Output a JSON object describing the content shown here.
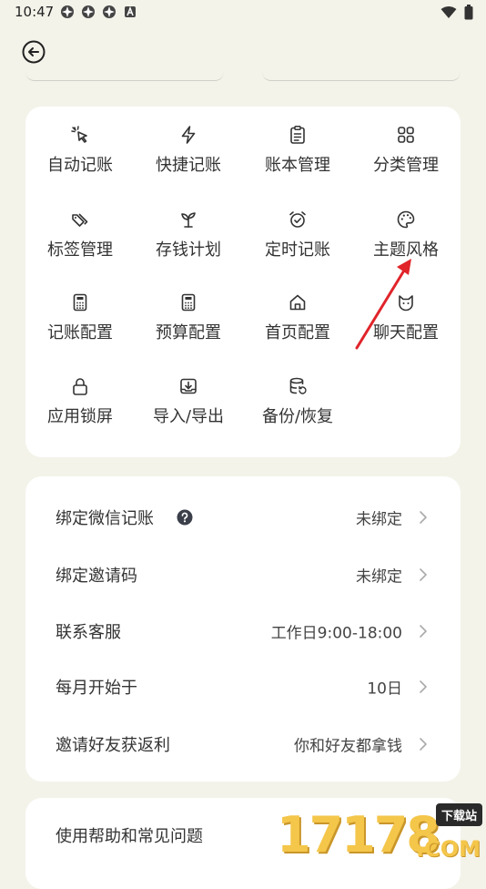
{
  "status_bar": {
    "time": "10:47"
  },
  "grid": [
    {
      "label": "自动记账",
      "icon": "cursor-click-icon"
    },
    {
      "label": "快捷记账",
      "icon": "lightning-icon"
    },
    {
      "label": "账本管理",
      "icon": "clipboard-icon"
    },
    {
      "label": "分类管理",
      "icon": "grid-icon"
    },
    {
      "label": "标签管理",
      "icon": "tags-icon"
    },
    {
      "label": "存钱计划",
      "icon": "sprout-icon"
    },
    {
      "label": "定时记账",
      "icon": "alarm-clock-icon"
    },
    {
      "label": "主题风格",
      "icon": "palette-icon"
    },
    {
      "label": "记账配置",
      "icon": "calculator-icon"
    },
    {
      "label": "预算配置",
      "icon": "calculator-icon"
    },
    {
      "label": "首页配置",
      "icon": "home-icon"
    },
    {
      "label": "聊天配置",
      "icon": "cat-icon"
    },
    {
      "label": "应用锁屏",
      "icon": "lock-icon"
    },
    {
      "label": "导入/导出",
      "icon": "download-tray-icon"
    },
    {
      "label": "备份/恢复",
      "icon": "database-restore-icon"
    }
  ],
  "settings": [
    {
      "label": "绑定微信记账",
      "value": "未绑定",
      "help": true
    },
    {
      "label": "绑定邀请码",
      "value": "未绑定"
    },
    {
      "label": "联系客服",
      "value": "工作日9:00-18:00"
    },
    {
      "label": "每月开始于",
      "value": "10日"
    },
    {
      "label": "邀请好友获返利",
      "value": "你和好友都拿钱"
    }
  ],
  "bottom": {
    "label": "使用帮助和常见问题"
  },
  "watermark": {
    "logo": "17178",
    "badge": "下载站",
    "suffix": ".COM"
  },
  "colors": {
    "background": "#f4f3ea",
    "card": "#ffffff",
    "arrow": "#e0242a"
  }
}
